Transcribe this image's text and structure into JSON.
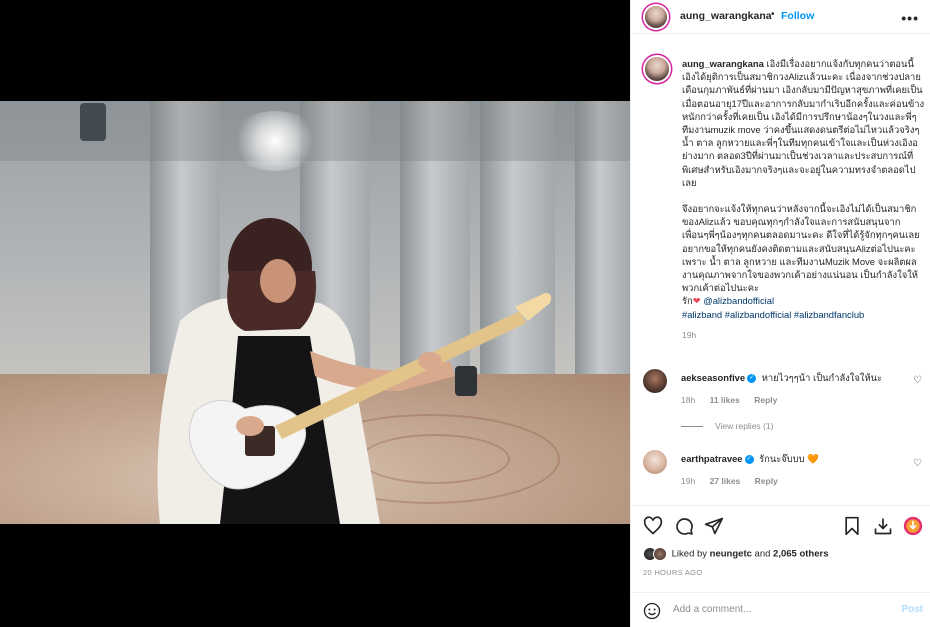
{
  "post": {
    "username": "aung_warangkana",
    "follow_label": "Follow",
    "separator": "•",
    "more_icon": "more-dots-icon"
  },
  "caption": {
    "username": "aung_warangkana",
    "paragraph1": "เอิงมีเรื่องอยากแจ้งกับทุกคนว่าตอนนี้เอิงได้ยุติการเป็นสมาชิกวงAlizแล้วนะคะ เนื่องจากช่วงปลายเดือนกุมภาพันธ์ที่ผ่านมา เอิงกลับมามีปัญหาสุขภาพที่เคยเป็นเมื่อตอนอายุ17ปีและอาการกลับมากำเริบอีกครั้งและค่อนข้างหนักกว่าครั้งที่เคยเป็น เอิงได้มีการปรึกษาน้องๆในวงและพี่ๆทีมงานmuzik move ว่าคงขึ้นแสดงดนตรีต่อไม่ไหวแล้วจริงๆ น้ำ ตาล ลูกหวายและพี่ๆในทีมทุกคนเข้าใจและเป็นห่วงเอิงอย่างมาก ตลอด3ปีที่ผ่านมาเป็นช่วงเวลาและประสบการณ์ที่พิเศษสำหรับเอิงมากจริงๆและจะอยู่ในความทรงจำตลอดไปเลย",
    "paragraph2": "จึงอยากจะแจ้งให้ทุกคนว่าหลังจากนี้จะเอิงไม่ได้เป็นสมาชิกของAlizแล้ว ขอบคุณทุกๆกำลังใจและการสนับสนุนจากเพื่อนๆพี่ๆน้องๆทุกคนตลอดมานะคะ ดีใจที่ได้รู้จักทุกๆคนเลย อยากขอให้ทุกคนยังคงติดตามและสนับสนุนAlizต่อไปนะคะ เพราะ น้ำ ตาล ลูกหวาย และทีมงานMuzik Move จะผลิตผลงานคุณภาพจากใจของพวกเค้าอย่างแน่นอน เป็นกำลังใจให้พวกเค้าต่อไปนะคะ",
    "love_text": "รัก",
    "mention": "@alizbandofficial",
    "hashtags": "#alizband #alizbandofficial #alizbandfanclub",
    "time": "19h"
  },
  "comments": [
    {
      "username": "aekseasonfive",
      "text": "หายไวๆๆน้า เป็นกำลังใจให้นะ",
      "time": "18h",
      "likes": "11 likes",
      "reply": "Reply",
      "view_replies": "View replies (1)"
    },
    {
      "username": "earthpatravee",
      "text": "รักนะจ๊บบบ",
      "emoji": "🧡",
      "time": "19h",
      "likes": "27 likes",
      "reply": "Reply"
    }
  ],
  "likes": {
    "prefix": "Liked by",
    "user": "neungetc",
    "and": "and",
    "others": "2,065 others"
  },
  "time_ago": "20 HOURS AGO",
  "add_comment": {
    "placeholder": "Add a comment...",
    "post_label": "Post"
  },
  "colors": {
    "link": "#0095f6",
    "tag": "#00376b",
    "muted": "#8e8e8e"
  }
}
